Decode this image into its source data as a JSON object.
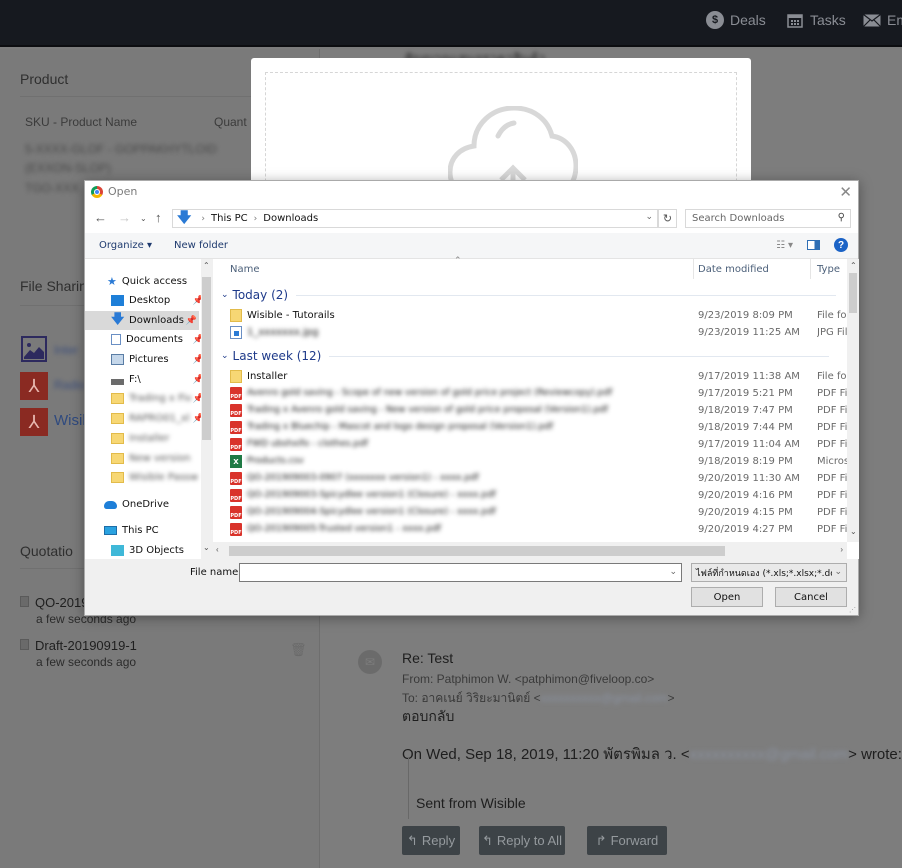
{
  "topnav": {
    "items": [
      {
        "label": "Deals",
        "icon": "dollar-circle-icon"
      },
      {
        "label": "Tasks",
        "icon": "calendar-icon"
      },
      {
        "label": "Em",
        "icon": "envelope-icon"
      }
    ]
  },
  "background": {
    "product": {
      "title": "Product",
      "col_sku": "SKU - Product Name",
      "col_qty": "Quant",
      "rows_blurred": [
        "5-XXXX-GLOF - GOPPAKHYTLOID",
        "(EXXON-SLOP)",
        "TGO-XXX"
      ]
    },
    "file_sharing": {
      "title": "File Sharin",
      "files": [
        {
          "type": "image",
          "name": "Inter"
        },
        {
          "type": "pdf",
          "name": "Radio"
        },
        {
          "type": "pdf",
          "name": "Wisib"
        }
      ]
    },
    "quotation": {
      "title": "Quotatio",
      "items": [
        {
          "name": "QO-2019",
          "time": "a few seconds ago"
        },
        {
          "name": "Draft-20190919-1",
          "time": "a few seconds ago"
        }
      ]
    },
    "email": {
      "header_blurred": "สัญญาณเสนอราคาสินค้า",
      "subject": "Re: Test",
      "from": "From: Patphimon W. <patphimon@fiveloop.co>",
      "to_prefix": "To: อาคเนย์ วิริยะมานิตย์ <",
      "to_blurred": "xxxxxxxxxx@gmail.com",
      "to_suffix": ">",
      "body_reply": "ตอบกลับ",
      "quote_header_prefix": "On Wed, Sep 18, 2019, 11:20 พัตรพิมล ว. <",
      "quote_header_blurred": "xxxxxxxxxx@gmail.com",
      "quote_header_suffix": "> wrote:",
      "quote_body": "Sent from Wisible",
      "buttons": {
        "reply": "Reply",
        "reply_all": "Reply to All",
        "forward": "Forward"
      }
    }
  },
  "upload_modal": {
    "icon": "cloud-upload-icon"
  },
  "dialog": {
    "title": "Open",
    "breadcrumb": [
      "This PC",
      "Downloads"
    ],
    "search_placeholder": "Search Downloads",
    "toolbar": {
      "organize": "Organize ▾",
      "new_folder": "New folder"
    },
    "nav_pane": [
      {
        "label": "Quick access",
        "icon": "star-icon",
        "pinned": false
      },
      {
        "label": "Desktop",
        "icon": "desktop-icon",
        "pinned": true
      },
      {
        "label": "Downloads",
        "icon": "downloads-icon",
        "pinned": true,
        "selected": true
      },
      {
        "label": "Documents",
        "icon": "documents-icon",
        "pinned": true
      },
      {
        "label": "Pictures",
        "icon": "pictures-icon",
        "pinned": true
      },
      {
        "label": "F:\\",
        "icon": "drive-icon",
        "pinned": true
      },
      {
        "label": "Trading x Fiv",
        "icon": "folder-icon",
        "pinned": true,
        "blurred": true
      },
      {
        "label": "RAPRO01_xl",
        "icon": "folder-icon",
        "pinned": true,
        "blurred": true
      },
      {
        "label": "Installer",
        "icon": "folder-icon",
        "pinned": false,
        "blurred": true
      },
      {
        "label": "New version",
        "icon": "folder-icon",
        "pinned": false,
        "blurred": true
      },
      {
        "label": "Wisible Passw",
        "icon": "folder-icon",
        "pinned": false,
        "blurred": true
      },
      {
        "label": "OneDrive",
        "icon": "onedrive-icon",
        "pinned": false
      },
      {
        "label": "This PC",
        "icon": "this-pc-icon",
        "pinned": false
      },
      {
        "label": "3D Objects",
        "icon": "3d-objects-icon",
        "pinned": false
      }
    ],
    "columns": {
      "name": "Name",
      "date": "Date modified",
      "type": "Type"
    },
    "groups": [
      {
        "label": "Today (2)",
        "files": [
          {
            "name": "Wisible - Tutorails",
            "icon": "folder",
            "date": "9/23/2019 8:09 PM",
            "type": "File folder",
            "blurred": false
          },
          {
            "name": "1_xxxxxxx.jpg",
            "icon": "jpg",
            "date": "9/23/2019 11:25 AM",
            "type": "JPG File",
            "blurred": true
          }
        ]
      },
      {
        "label": "Last week (12)",
        "files": [
          {
            "name": "Installer",
            "icon": "folder",
            "date": "9/17/2019 11:38 AM",
            "type": "File folder",
            "blurred": false
          },
          {
            "name": "Avenro gold saving - Scope of new version of gold price project (Reviewcopy).pdf",
            "icon": "pdf",
            "date": "9/17/2019 5:21 PM",
            "type": "PDF File",
            "blurred": true
          },
          {
            "name": "Trading x Avenro gold saving - New version of gold price proposal (Version1).pdf",
            "icon": "pdf",
            "date": "9/18/2019 7:47 PM",
            "type": "PDF File",
            "blurred": true
          },
          {
            "name": "Trading x Bluechip - Mascot and logo design proposal (Version1).pdf",
            "icon": "pdf",
            "date": "9/18/2019 7:44 PM",
            "type": "PDF File",
            "blurred": true
          },
          {
            "name": "FWD ubshxifo - clothes.pdf",
            "icon": "pdf",
            "date": "9/17/2019 11:04 AM",
            "type": "PDF File",
            "blurred": true
          },
          {
            "name": "Products.csv",
            "icon": "xls",
            "date": "9/18/2019 8:19 PM",
            "type": "Microsoft Excel",
            "blurred": true
          },
          {
            "name": "QO-201909003-0907 (xxxxxxx version1) - xxxx.pdf",
            "icon": "pdf",
            "date": "9/20/2019 11:30 AM",
            "type": "PDF File",
            "blurred": true
          },
          {
            "name": "QO-201909003-Spicydlee version1 (Closure) - xxxx.pdf",
            "icon": "pdf",
            "date": "9/20/2019 4:16 PM",
            "type": "PDF File",
            "blurred": true
          },
          {
            "name": "QO-201909004-Spicydlee version1 (Closure) - xxxx.pdf",
            "icon": "pdf",
            "date": "9/20/2019 4:15 PM",
            "type": "PDF File",
            "blurred": true
          },
          {
            "name": "QO-201909005-Trusted version1 - xxxx.pdf",
            "icon": "pdf",
            "date": "9/20/2019 4:27 PM",
            "type": "PDF File",
            "blurred": true
          }
        ]
      }
    ],
    "filename_label": "File name:",
    "filename_value": "",
    "filter_value": "ไฟล์ที่กำหนดเอง (*.xls;*.xlsx;*.doc",
    "open_button": "Open",
    "cancel_button": "Cancel"
  }
}
